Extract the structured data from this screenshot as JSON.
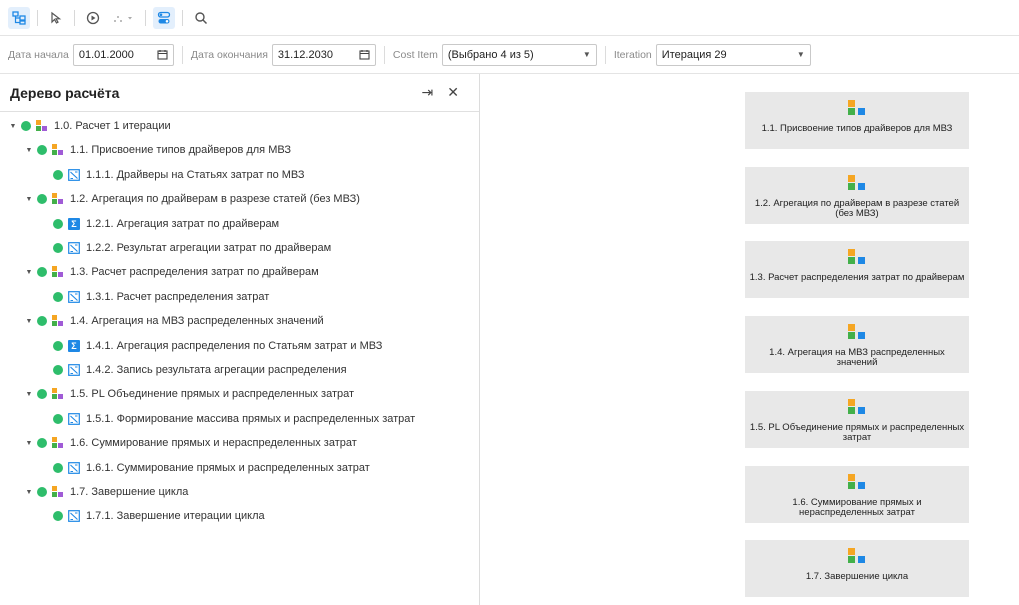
{
  "filters": {
    "start_label": "Дата начала",
    "start_value": "01.01.2000",
    "end_label": "Дата окончания",
    "end_value": "31.12.2030",
    "cost_label": "Cost Item",
    "cost_value": "(Выбрано 4 из 5)",
    "iter_label": "Iteration",
    "iter_value": "Итерация 29"
  },
  "panel": {
    "title": "Дерево расчёта"
  },
  "tree": [
    {
      "label": "1.0. Расчет 1 итерации",
      "level": 0,
      "icon": "group-icon",
      "expanded": true
    },
    {
      "label": "1.1. Присвоение типов драйверов для МВЗ",
      "level": 1,
      "icon": "group-icon",
      "expanded": true
    },
    {
      "label": "1.1.1. Драйверы на Статьях затрат по МВЗ",
      "level": 2,
      "icon": "transform-icon"
    },
    {
      "label": "1.2. Агрегация по драйверам в разрезе статей (без МВЗ)",
      "level": 1,
      "icon": "group-icon",
      "expanded": true
    },
    {
      "label": "1.2.1. Агрегация затрат по драйверам",
      "level": 2,
      "icon": "sigma-icon"
    },
    {
      "label": "1.2.2. Результат агрегации затрат по драйверам",
      "level": 2,
      "icon": "transform-icon"
    },
    {
      "label": "1.3. Расчет распределения затрат по драйверам",
      "level": 1,
      "icon": "group-icon",
      "expanded": true
    },
    {
      "label": "1.3.1. Расчет распределения затрат",
      "level": 2,
      "icon": "transform-icon"
    },
    {
      "label": "1.4. Агрегация на МВЗ распределенных значений",
      "level": 1,
      "icon": "group-icon",
      "expanded": true
    },
    {
      "label": "1.4.1. Агрегация распределения по Статьям затрат и МВЗ",
      "level": 2,
      "icon": "sigma-icon"
    },
    {
      "label": "1.4.2. Запись результата агрегации распределения",
      "level": 2,
      "icon": "transform-icon"
    },
    {
      "label": "1.5. PL Объединение прямых и распределенных затрат",
      "level": 1,
      "icon": "group-icon",
      "expanded": true
    },
    {
      "label": "1.5.1. Формирование массива прямых и распределенных затрат",
      "level": 2,
      "icon": "transform-icon"
    },
    {
      "label": "1.6. Суммирование прямых и нераспределенных затрат",
      "level": 1,
      "icon": "group-icon",
      "expanded": true
    },
    {
      "label": "1.6.1. Суммирование прямых и распределенных затрат",
      "level": 2,
      "icon": "transform-icon"
    },
    {
      "label": "1.7. Завершение цикла",
      "level": 1,
      "icon": "group-icon",
      "expanded": true
    },
    {
      "label": "1.7.1. Завершение итерации цикла",
      "level": 2,
      "icon": "transform-icon"
    }
  ],
  "cards": [
    {
      "label": "1.1. Присвоение типов драйверов для МВЗ"
    },
    {
      "label": "1.2. Агрегация по драйверам в разрезе статей (без МВЗ)"
    },
    {
      "label": "1.3. Расчет распределения затрат по драйверам"
    },
    {
      "label": "1.4. Агрегация на МВЗ распределенных значений"
    },
    {
      "label": "1.5. PL Объединение прямых и распределенных затрат"
    },
    {
      "label": "1.6. Суммирование прямых и нераспределенных затрат"
    },
    {
      "label": "1.7. Завершение цикла"
    }
  ],
  "colors": {
    "status_green": "#2ebd6b",
    "accent_blue": "#1e88e5",
    "orange": "#f5a623",
    "green": "#43b04a",
    "purple": "#a05bd6",
    "card_bg": "#e8e8e8"
  }
}
